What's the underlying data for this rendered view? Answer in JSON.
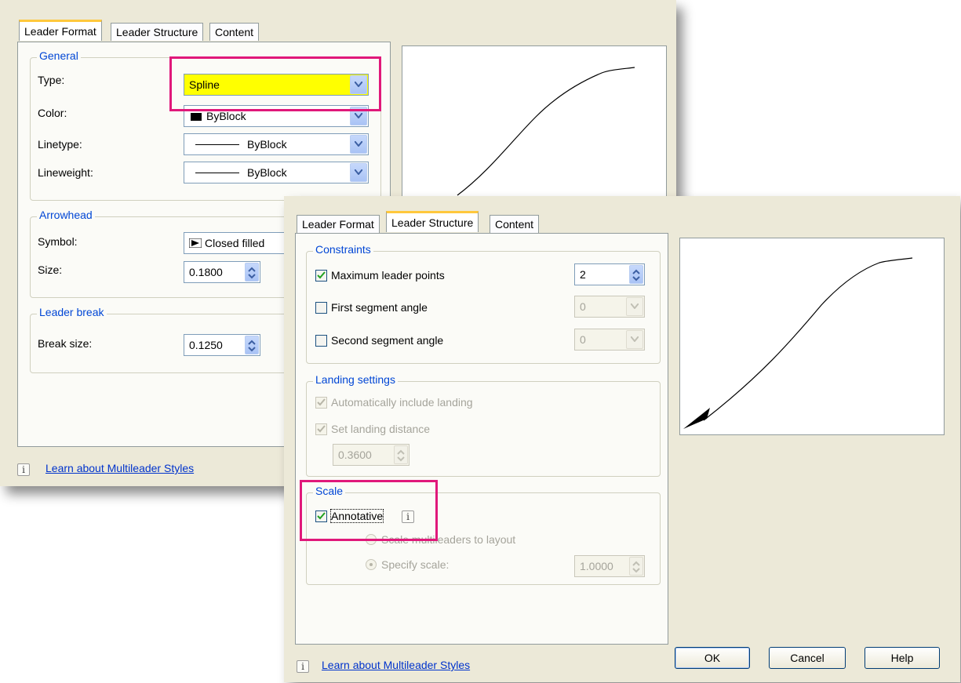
{
  "back_dialog": {
    "tabs": [
      "Leader Format",
      "Leader Structure",
      "Content"
    ],
    "active_tab": "Leader Format",
    "general": {
      "title": "General",
      "type_label": "Type:",
      "type_value": "Spline",
      "color_label": "Color:",
      "color_value": "ByBlock",
      "linetype_label": "Linetype:",
      "linetype_value": "ByBlock",
      "lineweight_label": "Lineweight:",
      "lineweight_value": "ByBlock"
    },
    "arrowhead": {
      "title": "Arrowhead",
      "symbol_label": "Symbol:",
      "symbol_value": "Closed filled",
      "size_label": "Size:",
      "size_value": "0.1800"
    },
    "leader_break": {
      "title": "Leader break",
      "break_size_label": "Break size:",
      "break_size_value": "0.1250"
    },
    "learn_link": "Learn about Multileader Styles"
  },
  "front_dialog": {
    "tabs": [
      "Leader Format",
      "Leader Structure",
      "Content"
    ],
    "active_tab": "Leader Structure",
    "constraints": {
      "title": "Constraints",
      "max_points_label": "Maximum leader points",
      "max_points_checked": true,
      "max_points_value": "2",
      "first_angle_label": "First segment angle",
      "first_angle_checked": false,
      "first_angle_value": "0",
      "second_angle_label": "Second segment angle",
      "second_angle_checked": false,
      "second_angle_value": "0"
    },
    "landing": {
      "title": "Landing settings",
      "auto_include_label": "Automatically include landing",
      "auto_include_checked": true,
      "set_distance_label": "Set landing distance",
      "set_distance_checked": true,
      "distance_value": "0.3600"
    },
    "scale": {
      "title": "Scale",
      "annotative_label": "Annotative",
      "annotative_checked": true,
      "scale_to_layout_label": "Scale multileaders to layout",
      "specify_scale_label": "Specify scale:",
      "specify_scale_value": "1.0000"
    },
    "learn_link": "Learn about Multileader Styles",
    "buttons": {
      "ok": "OK",
      "cancel": "Cancel",
      "help": "Help"
    }
  },
  "colors": {
    "highlight": "#e0187a",
    "type_field": "#ffff00",
    "group_title": "#0046d5"
  }
}
